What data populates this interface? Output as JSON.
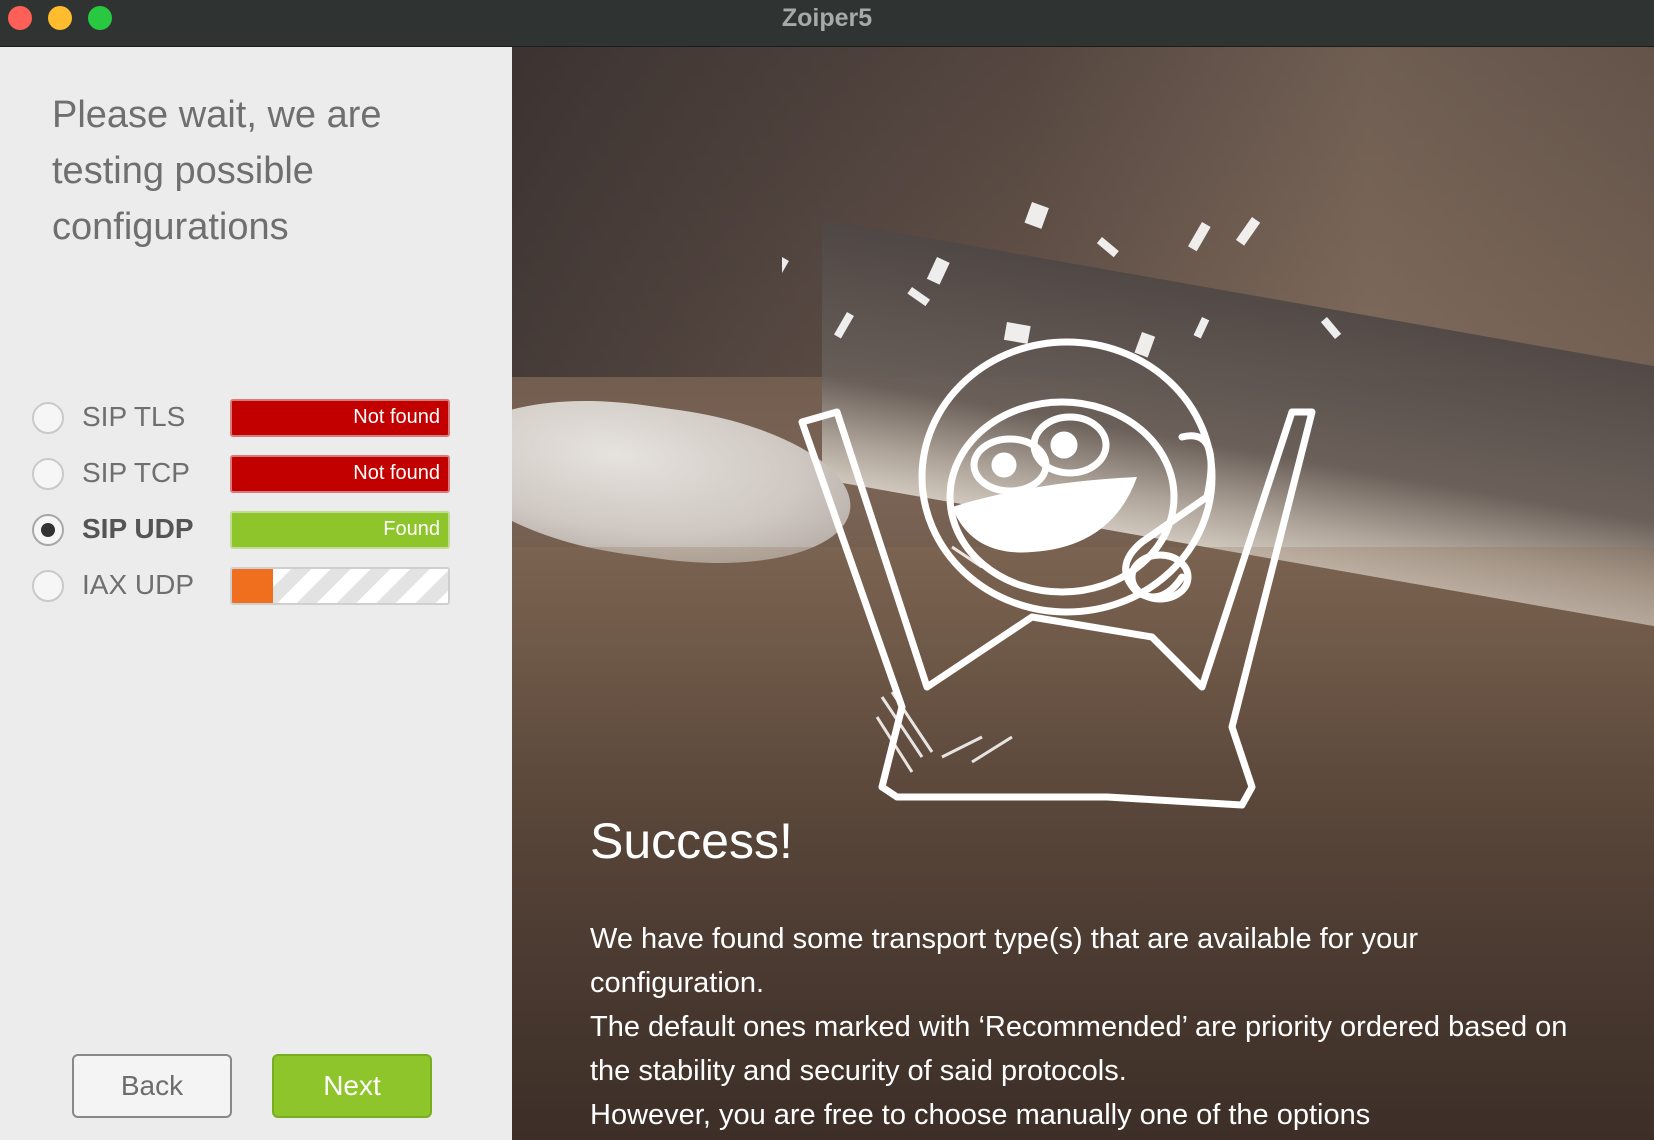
{
  "window": {
    "title": "Zoiper5"
  },
  "left": {
    "heading": " Please wait, we are\ntesting possible\nconfigurations",
    "transports": [
      {
        "label": "SIP TLS",
        "status": "Not found",
        "selected": false
      },
      {
        "label": "SIP TCP",
        "status": "Not found",
        "selected": false
      },
      {
        "label": "SIP UDP",
        "status": "Found",
        "selected": true
      },
      {
        "label": "IAX UDP",
        "status": "",
        "selected": false,
        "progress": 0.19
      }
    ],
    "back_label": "Back",
    "next_label": "Next"
  },
  "right": {
    "title": "Success!",
    "paragraph1": " We have found some transport type(s) that are available for your configuration.",
    "paragraph2": "The default ones marked with ‘Recommended’ are priority ordered based on the stability and security of said protocols.",
    "paragraph3": "However, you are free to choose manually one of the options"
  },
  "colors": {
    "not_found": "#c30000",
    "found": "#8dc52b",
    "progress": "#ef6f1e",
    "accent_green": "#8dc52b"
  },
  "icons": {
    "mascot": "celebrating-mascot-icon"
  }
}
